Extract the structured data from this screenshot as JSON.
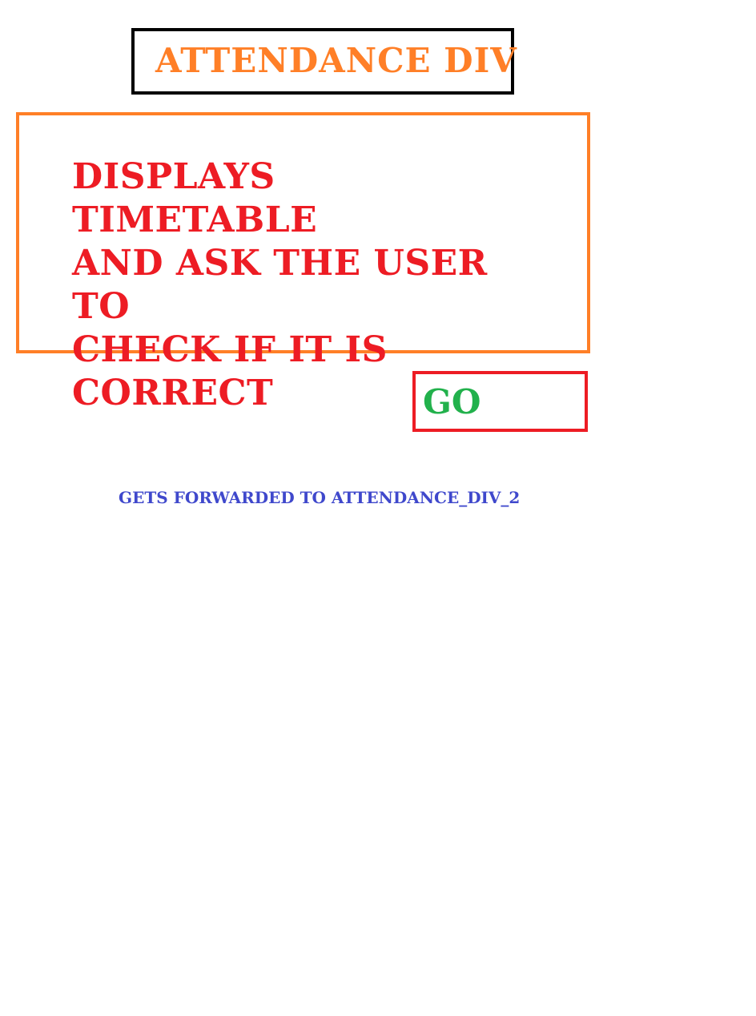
{
  "title": {
    "text": "ATTENDANCE DIV",
    "color": "#ff7f27",
    "border_color": "#000000"
  },
  "description": {
    "lines": [
      "DISPLAYS TIMETABLE",
      "AND ASK THE USER TO",
      "CHECK IF IT IS",
      "CORRECT"
    ],
    "color": "#ed1c24",
    "border_color": "#ff7f27"
  },
  "go_button": {
    "label": "GO",
    "color": "#22b14c",
    "border_color": "#ed1c24"
  },
  "note": {
    "text": "GETS FORWARDED TO ATTENDANCE_DIV_2",
    "color": "#3f48cc"
  }
}
